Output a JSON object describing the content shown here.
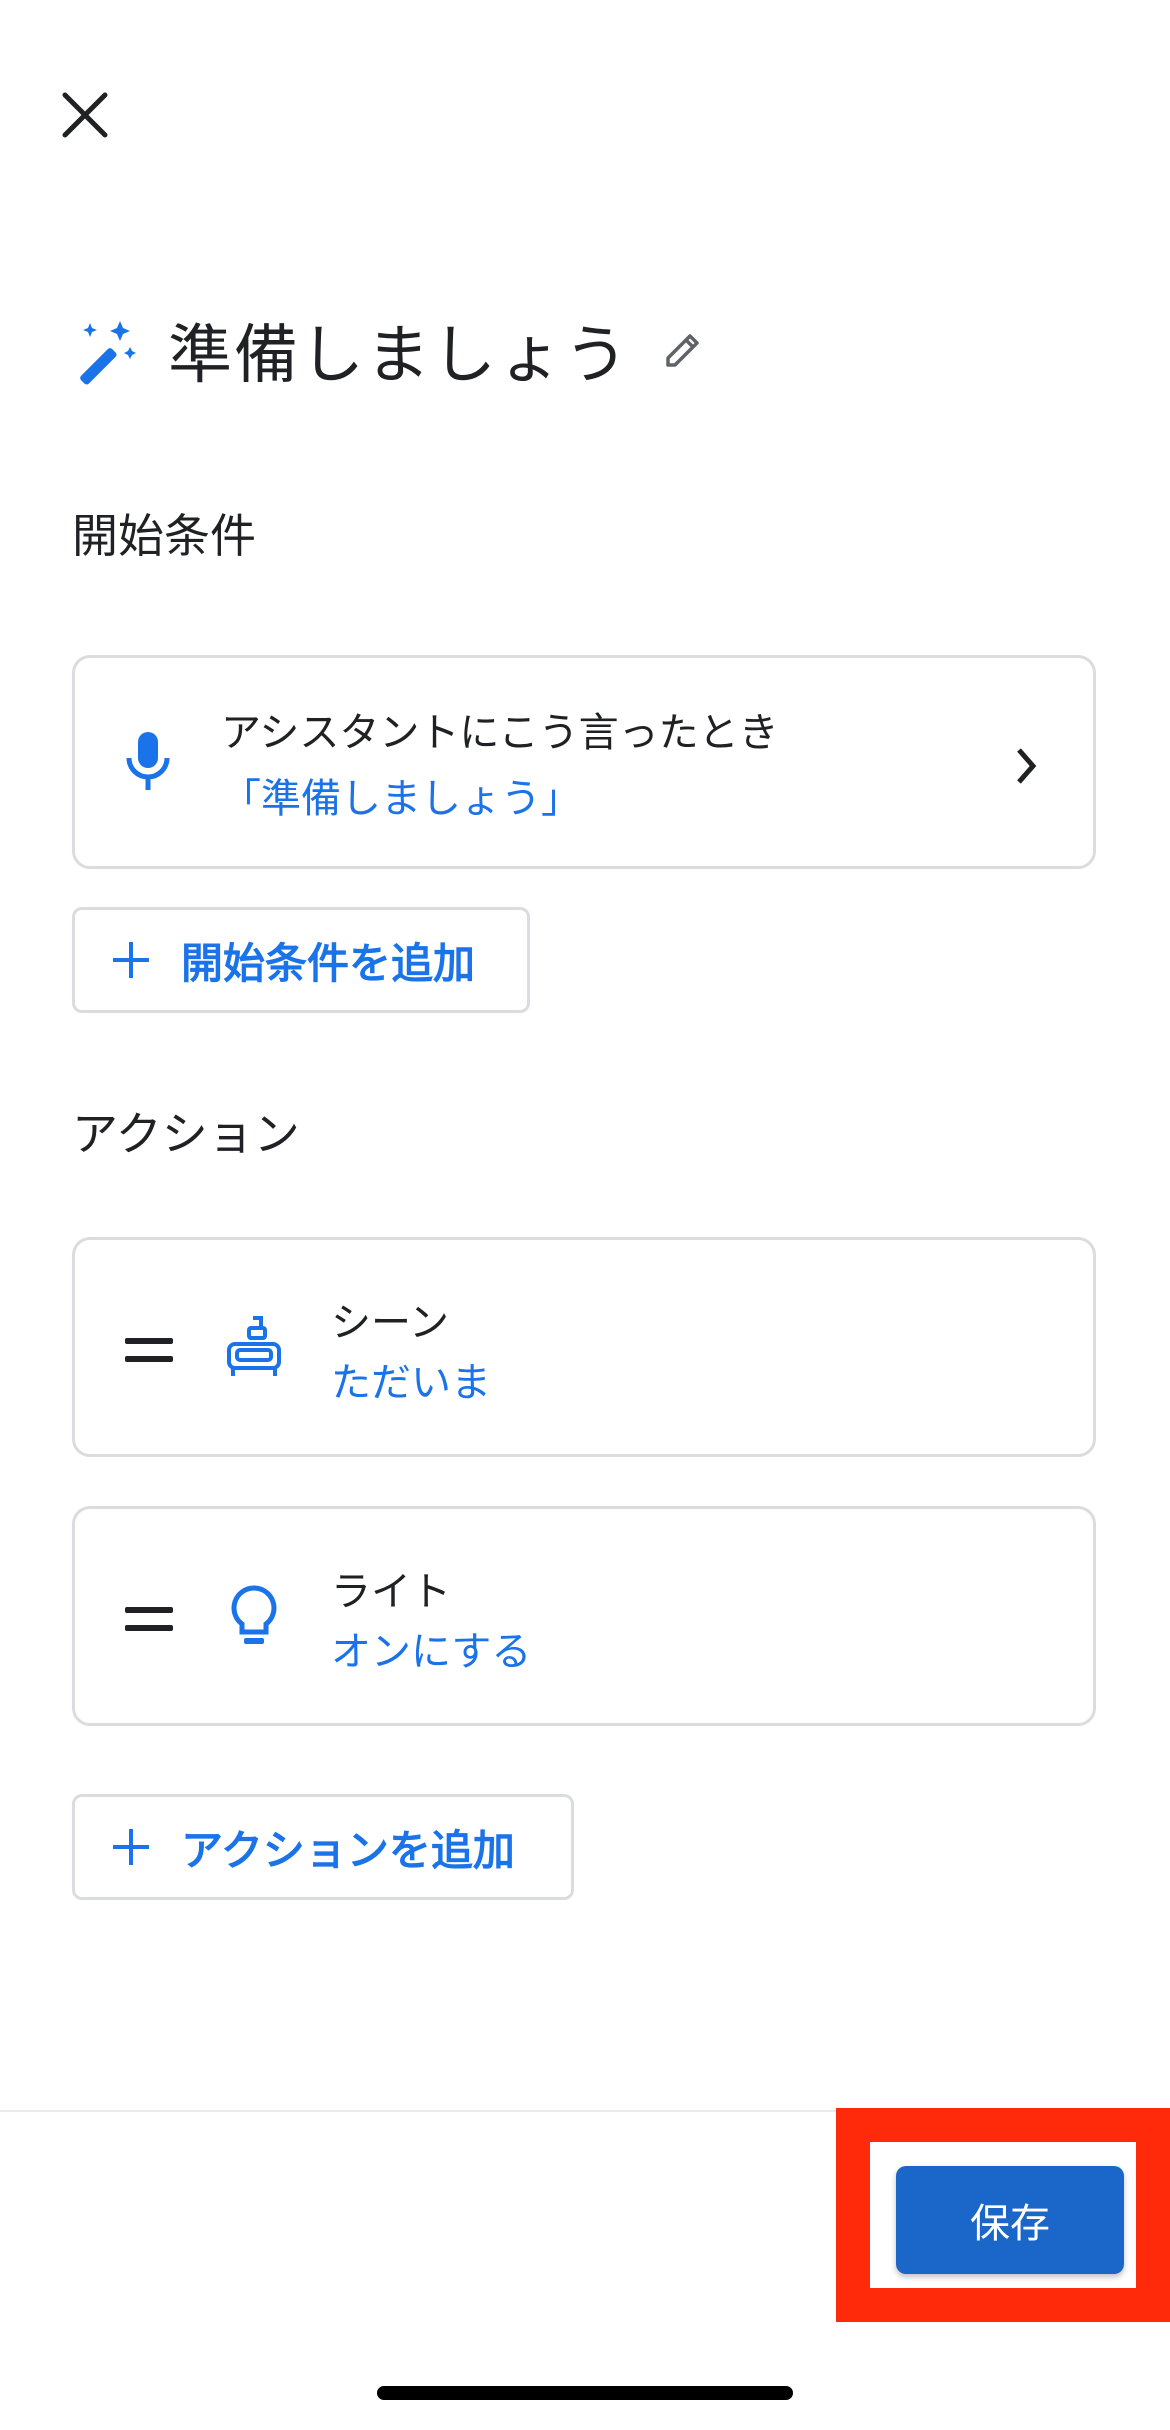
{
  "header": {
    "close_icon": "close-icon"
  },
  "routine": {
    "title": "準備しましょう",
    "icon": "magic-wand-icon",
    "edit_icon": "pencil-icon"
  },
  "starters": {
    "section_label": "開始条件",
    "items": [
      {
        "icon": "microphone-icon",
        "label": "アシスタントにこう言ったとき",
        "value": "「準備しましょう」"
      }
    ],
    "add_label": "開始条件を追加"
  },
  "actions": {
    "section_label": "アクション",
    "items": [
      {
        "icon": "scene-icon",
        "label": "シーン",
        "value": "ただいま"
      },
      {
        "icon": "lightbulb-icon",
        "label": "ライト",
        "value": "オンにする"
      }
    ],
    "add_label": "アクションを追加"
  },
  "footer": {
    "save_label": "保存"
  },
  "colors": {
    "accent": "#1a73e8",
    "save_button": "#1a66c9",
    "highlight": "#ff2a0a"
  }
}
